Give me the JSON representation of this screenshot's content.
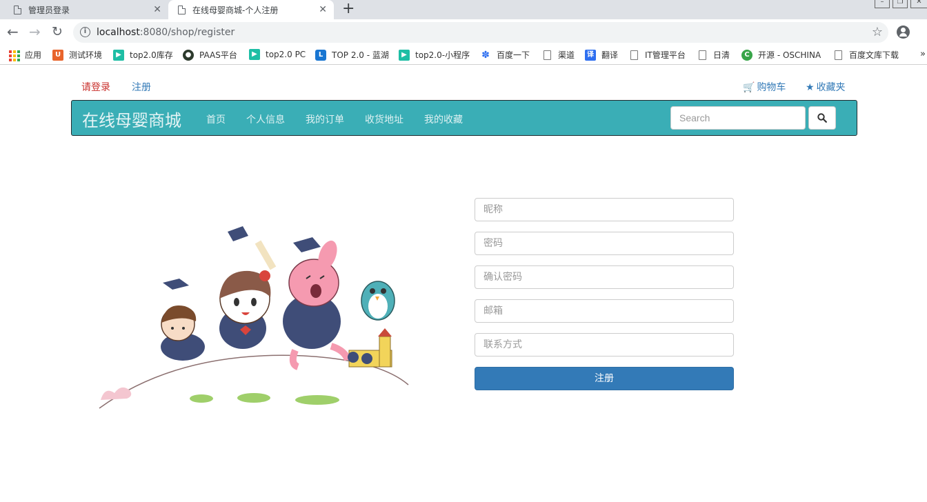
{
  "browser": {
    "tabs": [
      {
        "title": "管理员登录",
        "active": false
      },
      {
        "title": "在线母婴商城-个人注册",
        "active": true
      }
    ],
    "new_tab": "+",
    "url_host": "localhost",
    "url_path": ":8080/shop/register",
    "bookmarks": [
      {
        "label": "应用",
        "icon": "apps-icon"
      },
      {
        "label": "测试环境",
        "icon": "u-icon"
      },
      {
        "label": "top2.0库存",
        "icon": "play-icon"
      },
      {
        "label": "PAAS平台",
        "icon": "paas-icon"
      },
      {
        "label": "top2.0 PC",
        "icon": "play-icon"
      },
      {
        "label": "TOP 2.0 - 蓝湖",
        "icon": "lanhu-icon"
      },
      {
        "label": "top2.0-小程序",
        "icon": "play-icon"
      },
      {
        "label": "百度一下",
        "icon": "baidu-icon"
      },
      {
        "label": "渠道",
        "icon": "page-icon"
      },
      {
        "label": "翻译",
        "icon": "fanyi-icon"
      },
      {
        "label": "IT管理平台",
        "icon": "page-icon"
      },
      {
        "label": "日清",
        "icon": "page-icon"
      },
      {
        "label": "开源 - OSCHINA",
        "icon": "oschina-icon"
      },
      {
        "label": "百度文库下载",
        "icon": "page-icon"
      }
    ],
    "bookmarks_more": "»"
  },
  "header": {
    "login": "请登录",
    "register": "注册",
    "cart": "购物车",
    "favorites": "收藏夹"
  },
  "navbar": {
    "brand": "在线母婴商城",
    "items": [
      "首页",
      "个人信息",
      "我的订单",
      "收货地址",
      "我的收藏"
    ],
    "search_placeholder": "Search",
    "accent": "#3aaeb6"
  },
  "form": {
    "nickname_placeholder": "昵称",
    "password_placeholder": "密码",
    "confirm_placeholder": "确认密码",
    "email_placeholder": "邮箱",
    "contact_placeholder": "联系方式",
    "submit": "注册",
    "button_color": "#337ab7"
  }
}
